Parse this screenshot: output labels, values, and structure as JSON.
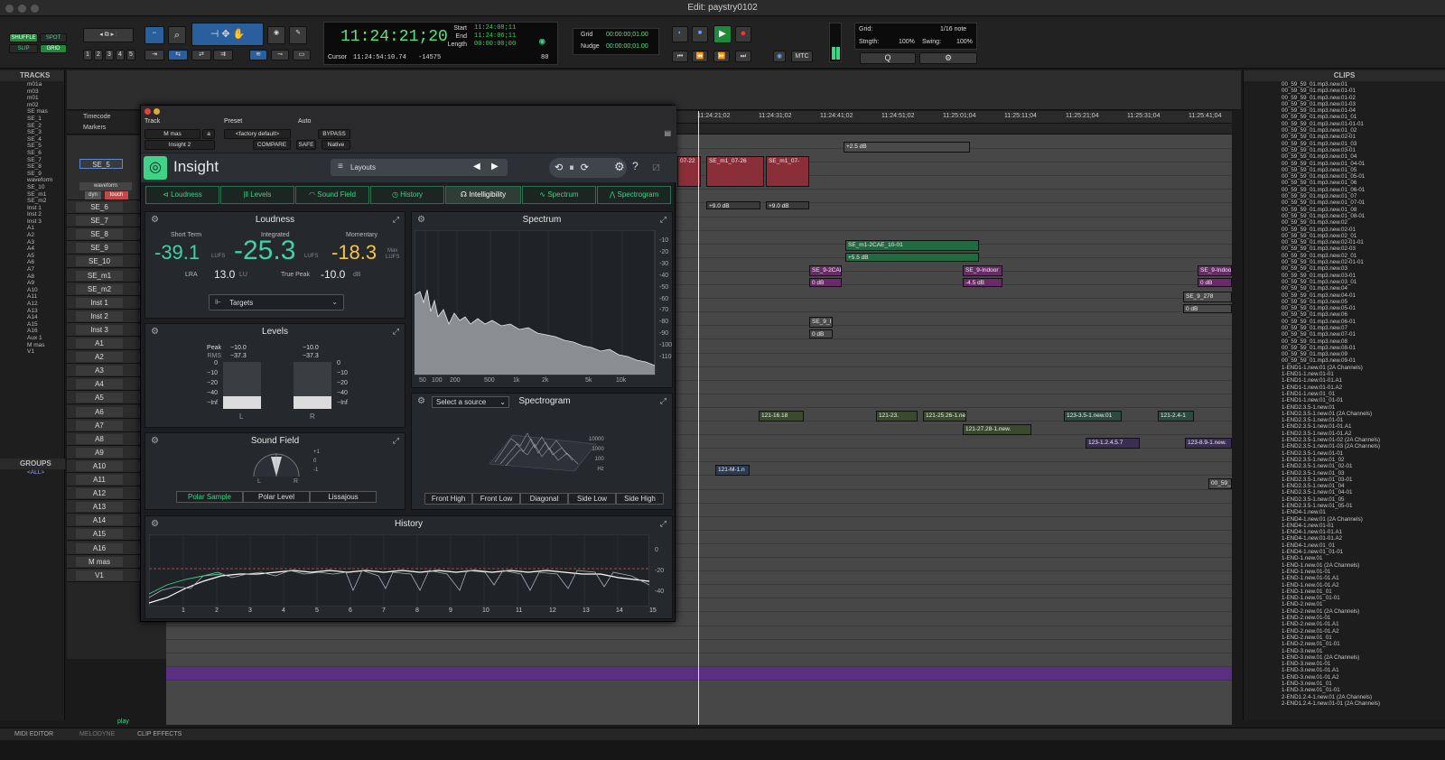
{
  "window": {
    "title": "Edit: paystry0102"
  },
  "toolbar": {
    "modes": [
      "SHUFFLE",
      "SPOT",
      "SLIP",
      "GRID"
    ],
    "zoom_presets": [
      "1",
      "2",
      "3",
      "4",
      "5"
    ],
    "main_counter": "11:24:21;20",
    "start_label": "Start",
    "end_label": "End",
    "length_label": "Length",
    "start": "11:24:08;11",
    "end": "11:24:06;11",
    "length": "00:00:00;00",
    "cursor_label": "Cursor",
    "cursor": "11:24:54:10.74",
    "cursor_db": "-14575",
    "nudge_value_small": "80",
    "grid_label": "Grid",
    "grid_value": "00:00:00;01.00",
    "nudge_label": "Nudge",
    "nudge_value": "00:00:00;01.00",
    "mtc": "MTC",
    "grid_note_label": "Grid:",
    "grid_note": "1/16 note",
    "strength_label": "Stngth:",
    "strength": "100%",
    "swing_label": "Swing:",
    "swing": "100%",
    "q_label": "Q"
  },
  "tracks_panel": {
    "title": "TRACKS",
    "items": [
      "m01a",
      "m03",
      "m01",
      "m02",
      "SE mas",
      "SE_1",
      "SE_2",
      "SE_3",
      "SE_4",
      "SE_5",
      "SE_6",
      "SE_7",
      "SE_8",
      "SE_9",
      "waveform",
      "SE_10",
      "SE_m1",
      "SE_m2",
      "Inst 1",
      "Inst 2",
      "Inst 3",
      "A1",
      "A2",
      "A3",
      "A4",
      "A5",
      "A6",
      "A7",
      "A8",
      "A9",
      "A10",
      "A11",
      "A12",
      "A13",
      "A14",
      "A15",
      "A16",
      "Aux 1",
      "M mas",
      "V1"
    ]
  },
  "groups_panel": {
    "title": "GROUPS",
    "item": "<ALL>"
  },
  "ruler": {
    "timecode_label": "Timecode",
    "markers_label": "Markers",
    "ticks": [
      "11:24:21;02",
      "11:24:31;02",
      "11:24:41;02",
      "11:24:51;02",
      "11:25:01;04",
      "11:25:11;04",
      "11:25:21;04",
      "11:25:31;04",
      "11:25:41;04"
    ]
  },
  "track_heads": [
    {
      "name": "SE_6"
    },
    {
      "name": "SE_7"
    },
    {
      "name": "SE_8"
    },
    {
      "name": "SE_9"
    },
    {
      "name": "SE_10"
    },
    {
      "name": "SE_m1"
    },
    {
      "name": "SE_m2"
    },
    {
      "name": "Inst 1"
    },
    {
      "name": "Inst 2"
    },
    {
      "name": "Inst 3"
    },
    {
      "name": "A1"
    },
    {
      "name": "A2"
    },
    {
      "name": "A3"
    },
    {
      "name": "A4"
    },
    {
      "name": "A5"
    },
    {
      "name": "A6"
    },
    {
      "name": "A7"
    },
    {
      "name": "A8"
    },
    {
      "name": "A9"
    },
    {
      "name": "A10"
    },
    {
      "name": "A11"
    },
    {
      "name": "A12"
    },
    {
      "name": "A13"
    },
    {
      "name": "A14"
    },
    {
      "name": "A15"
    },
    {
      "name": "A16"
    },
    {
      "name": "M mas"
    },
    {
      "name": "V1"
    }
  ],
  "track_head_top": {
    "name": "SE_5",
    "view": "waveform",
    "dyn": "dyn",
    "touch": "touch",
    "frame_rate": "29.97",
    "vol": "vol",
    "wave": "wave"
  },
  "clips_timeline": [
    {
      "label": "07-22"
    },
    {
      "label": "SE_m1_07-26"
    },
    {
      "label": "SE_m1_07-"
    },
    {
      "label": "+9.0 dB"
    },
    {
      "label": "+9.0 dB"
    },
    {
      "label": "+2.5 dB"
    },
    {
      "label": "SE_m1-2CAE_10-01"
    },
    {
      "label": "+5.5 dB"
    },
    {
      "label": "SE_9-2CAI"
    },
    {
      "label": "0 dB"
    },
    {
      "label": "SE_9-Indoor"
    },
    {
      "label": "-4.5 dB"
    },
    {
      "label": "SE_9-Indoo"
    },
    {
      "label": "0 dB"
    },
    {
      "label": "SE_9_278"
    },
    {
      "label": "0 dB"
    },
    {
      "label": "SE_9_I"
    },
    {
      "label": "0 dB"
    },
    {
      "label": "121-25.26-1.new."
    },
    {
      "label": "121-27.28-1.new."
    },
    {
      "label": "123-3.5-1.new.01"
    },
    {
      "label": "121-2.4-1"
    },
    {
      "label": "123-1.2.4.5.7"
    },
    {
      "label": "123-8.9-1.new."
    },
    {
      "label": "121-M-1.n"
    },
    {
      "label": "00_59_"
    },
    {
      "label": "121-16.18"
    },
    {
      "label": "121-23."
    }
  ],
  "clips_panel": {
    "title": "CLIPS",
    "items": [
      "00_59_59_01.mp3.new.01",
      "00_59_59_01.mp3.new.01-01",
      "00_59_59_01.mp3.new.01-02",
      "00_59_59_01.mp3.new.01-03",
      "00_59_59_01.mp3.new.01-04",
      "00_59_59_01.mp3.new.01_01",
      "00_59_59_01.mp3.new.01-01-01",
      "00_59_59_01.mp3.new.01_02",
      "00_59_59_01.mp3.new.02-01",
      "00_59_59_01.mp3.new.01_03",
      "00_59_59_01.mp3.new.03-01",
      "00_59_59_01.mp3.new.01_04",
      "00_59_59_01.mp3.new.01_04-01",
      "00_59_59_01.mp3.new.01_05",
      "00_59_59_01.mp3.new.01_05-01",
      "00_59_59_01.mp3.new.01_06",
      "00_59_59_01.mp3.new.01_06-01",
      "00_59_59_01.mp3.new.01_07",
      "00_59_59_01.mp3.new.01_07-01",
      "00_59_59_01.mp3.new.01_08",
      "00_59_59_01.mp3.new.01_08-01",
      "00_59_59_01.mp3.new.02",
      "00_59_59_01.mp3.new.02-01",
      "00_59_59_01.mp3.new.02_01",
      "00_59_59_01.mp3.new.02-01-01",
      "00_59_59_01.mp3.new.02-03",
      "00_59_59_01.mp3.new.02_01",
      "00_59_59_01.mp3.new.02-01-01",
      "00_59_59_01.mp3.new.03",
      "00_59_59_01.mp3.new.03-01",
      "00_59_59_01.mp3.new.03_01",
      "00_59_59_01.mp3.new.04",
      "00_59_59_01.mp3.new.04-01",
      "00_59_59_01.mp3.new.05",
      "00_59_59_01.mp3.new.05-01",
      "00_59_59_01.mp3.new.06",
      "00_59_59_01.mp3.new.06-01",
      "00_59_59_01.mp3.new.07",
      "00_59_59_01.mp3.new.07-01",
      "00_59_59_01.mp3.new.08",
      "00_59_59_01.mp3.new.08-01",
      "00_59_59_01.mp3.new.09",
      "00_59_59_01.mp3.new.09-01",
      "1-END1-1.new.01 (2A Channels)",
      "1-END1-1.new.01-01",
      "1-END1-1.new.01-01.A1",
      "1-END1-1.new.01-01.A2",
      "1-END1-1.new.01_01",
      "1-END1-1.new.01_01-01",
      "1-END2.3.5-1.new.01",
      "1-END2.3.5-1.new.01 (2A Channels)",
      "1-END2.3.5-1.new.01-01",
      "1-END2.3.5-1.new.01-01.A1",
      "1-END2.3.5-1.new.01-01.A2",
      "1-END2.3.5-1.new.01-02 (2A Channels)",
      "1-END2.3.5-1.new.01-03 (2A Channels)",
      "1-END2.3.5-1.new.01-01",
      "1-END2.3.5-1.new.01_02",
      "1-END2.3.5-1.new.01_02-01",
      "1-END2.3.5-1.new.01_03",
      "1-END2.3.5-1.new.01_03-01",
      "1-END2.3.5-1.new.01_04",
      "1-END2.3.5-1.new.01_04-01",
      "1-END2.3.5-1.new.01_05",
      "1-END2.3.5-1.new.01_05-01",
      "1-END4-1.new.01",
      "1-END4-1.new.01 (2A Channels)",
      "1-END4-1.new.01-01",
      "1-END4-1.new.01-01.A1",
      "1-END4-1.new.01-01.A2",
      "1-END4-1.new.01_01",
      "1-END4-1.new.01_01-01",
      "1-END-1.new.01",
      "1-END-1.new.01 (2A Channels)",
      "1-END-1.new.01-01",
      "1-END-1.new.01-01.A1",
      "1-END-1.new.01-01.A2",
      "1-END-1.new.01_01",
      "1-END-1.new.01_01-01",
      "1-END-2.new.01",
      "1-END-2.new.01 (2A Channels)",
      "1-END-2.new.01-01",
      "1-END-2.new.01-01.A1",
      "1-END-2.new.01-01.A2",
      "1-END-2.new.01_01",
      "1-END-2.new.01_01-01",
      "1-END-3.new.01",
      "1-END-3.new.01 (2A Channels)",
      "1-END-3.new.01-01",
      "1-END-3.new.01-01.A1",
      "1-END-3.new.01-01.A2",
      "1-END-3.new.01_01",
      "1-END-3.new.01_01-01",
      "2-END1.2.4-1.new.01 (2A Channels)",
      "2-END1.2.4-1.new.01-01 (2A Channels)"
    ]
  },
  "bottom": {
    "tabs": [
      "MIDI EDITOR",
      "MELODYNE",
      "CLIP EFFECTS"
    ],
    "play": "play"
  },
  "plugin": {
    "track_label": "Track",
    "preset_label": "Preset",
    "auto_label": "Auto",
    "track_value": "M mas",
    "track_slot": "a",
    "insert": "Insight 2",
    "preset_value": "<factory default>",
    "compare": "COMPARE",
    "bypass": "BYPASS",
    "safe": "SAFE",
    "native": "Native",
    "name": "Insight",
    "layouts": "Layouts",
    "tabs": [
      "Loudness",
      "Levels",
      "Sound Field",
      "History",
      "Intelligibility",
      "Spectrum",
      "Spectrogram"
    ],
    "loudness": {
      "title": "Loudness",
      "short_term_label": "Short Term",
      "integrated_label": "Integrated",
      "momentary_label": "Momentary",
      "short_term": "-39.1",
      "integrated": "-25.3",
      "momentary": "-18.3",
      "unit": "LUFS",
      "max_label": "Max",
      "lra_label": "LRA",
      "lra": "13.0",
      "lra_unit": "LU",
      "true_peak_label": "True Peak",
      "true_peak": "-10.0",
      "tp_unit": "dB",
      "targets": "Targets"
    },
    "levels": {
      "title": "Levels",
      "peak_label": "Peak",
      "rms_label": "RMS",
      "peak_l": "−10.0",
      "rms_l": "−37.3",
      "peak_r": "−10.0",
      "rms_r": "−37.3",
      "scale": [
        "0",
        "−10",
        "−20",
        "−40",
        "−Inf"
      ],
      "left": "L",
      "right": "R",
      "fill_l": 0.27,
      "fill_r": 0.27
    },
    "soundfield": {
      "title": "Sound Field",
      "scale": [
        "+1",
        "0",
        "-1"
      ],
      "left": "L",
      "right": "R",
      "modes": [
        "Polar Sample",
        "Polar Level",
        "Lissajous"
      ]
    },
    "spectrum": {
      "title": "Spectrum",
      "db_ticks": [
        "-10",
        "-20",
        "-30",
        "-40",
        "-50",
        "-60",
        "-70",
        "-80",
        "-90",
        "-100",
        "-110"
      ],
      "hz_ticks": [
        "50",
        "100",
        "200",
        "500",
        "1k",
        "2k",
        "5k",
        "10k"
      ]
    },
    "spectrogram": {
      "title": "Spectrogram",
      "source": "Select a source",
      "axis": [
        "10000",
        "1000",
        "100",
        "Hz"
      ],
      "views": [
        "Front High",
        "Front Low",
        "Diagonal",
        "Side Low",
        "Side High"
      ]
    },
    "history": {
      "title": "History",
      "y_ticks": [
        "0",
        "-20",
        "-40"
      ],
      "x_ticks": [
        "1",
        "2",
        "3",
        "4",
        "5",
        "6",
        "7",
        "8",
        "9",
        "10",
        "11",
        "12",
        "13",
        "14",
        "15"
      ]
    }
  }
}
